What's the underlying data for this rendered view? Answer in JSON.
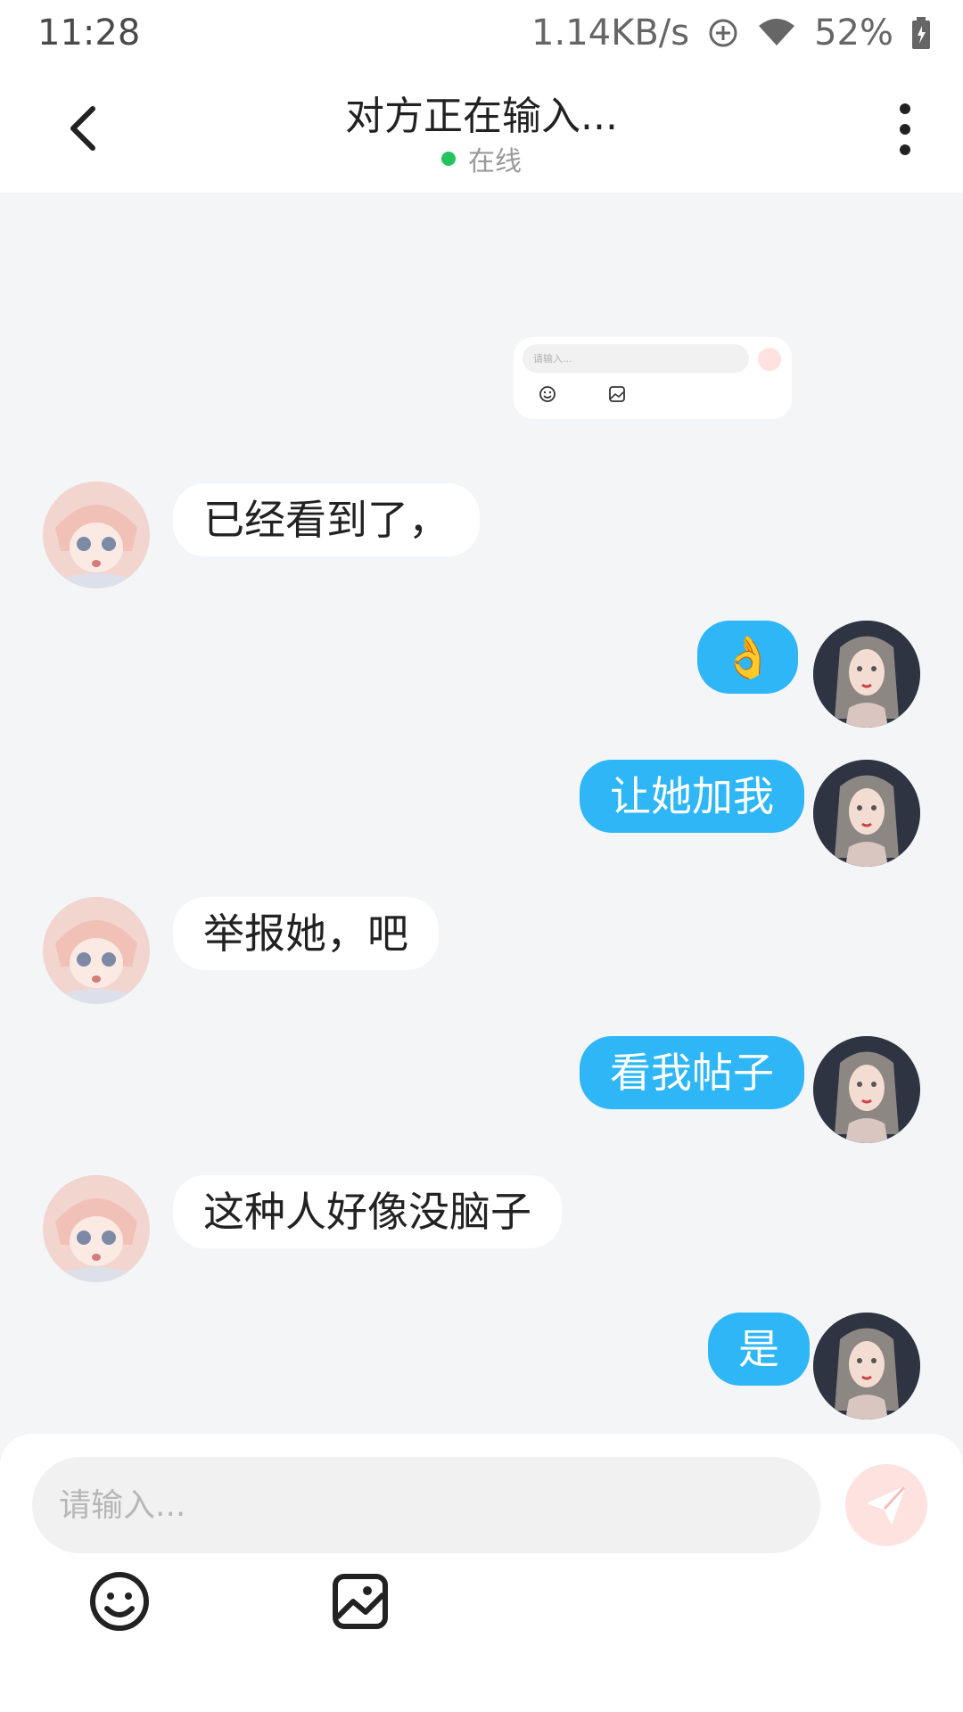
{
  "status_bar": {
    "time": "11:28",
    "network_speed": "1.14KB/s",
    "battery": "52%"
  },
  "header": {
    "title": "对方正在输入...",
    "presence": "在线"
  },
  "preview": {
    "placeholder": "请输入..."
  },
  "messages": [
    {
      "from": "them",
      "text": "已经看到了，"
    },
    {
      "from": "me",
      "text": "👌"
    },
    {
      "from": "me",
      "text": "让她加我"
    },
    {
      "from": "them",
      "text": "举报她，吧"
    },
    {
      "from": "me",
      "text": "看我帖子"
    },
    {
      "from": "them",
      "text": "这种人好像没脑子"
    },
    {
      "from": "me",
      "text": "是"
    }
  ],
  "composer": {
    "placeholder": "请输入..."
  },
  "colors": {
    "my_bubble": "#2fb6f6",
    "their_bubble": "#ffffff",
    "online_dot": "#22c55e",
    "send_button": "#fde2e0"
  },
  "icons": {
    "back": "chevron-left-icon",
    "more": "more-vertical-icon",
    "emoji": "smile-icon",
    "image": "image-icon",
    "send": "paper-plane-icon"
  }
}
